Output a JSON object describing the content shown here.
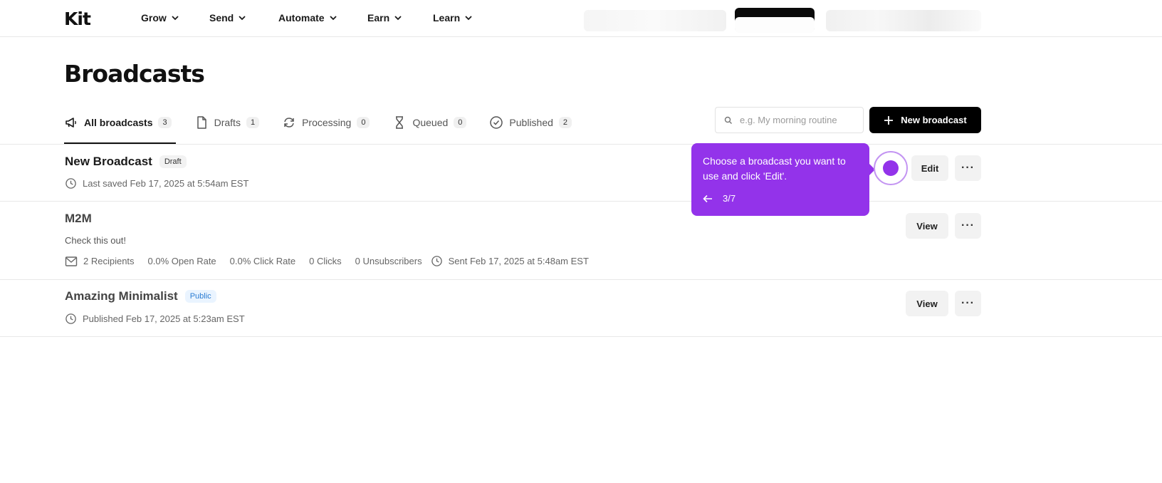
{
  "nav": {
    "logo": "Kit",
    "items": [
      "Grow",
      "Send",
      "Automate",
      "Earn",
      "Learn"
    ]
  },
  "page": {
    "title": "Broadcasts"
  },
  "tabs": [
    {
      "label": "All broadcasts",
      "count": "3",
      "icon": "megaphone-icon"
    },
    {
      "label": "Drafts",
      "count": "1",
      "icon": "document-icon"
    },
    {
      "label": "Processing",
      "count": "0",
      "icon": "refresh-icon"
    },
    {
      "label": "Queued",
      "count": "0",
      "icon": "hourglass-icon"
    },
    {
      "label": "Published",
      "count": "2",
      "icon": "check-circle-icon"
    }
  ],
  "search": {
    "placeholder": "e.g. My morning routine"
  },
  "new_broadcast_label": "New broadcast",
  "broadcasts": [
    {
      "title": "New Broadcast",
      "badge": "Draft",
      "meta": "Last saved Feb 17, 2025 at 5:54am EST",
      "action": "Edit"
    },
    {
      "title": "M2M",
      "description": "Check this out!",
      "stats": {
        "recipients": "2 Recipients",
        "open_rate": "0.0% Open Rate",
        "click_rate": "0.0% Click Rate",
        "clicks": "0 Clicks",
        "unsubscribers": "0 Unsubscribers",
        "sent": "Sent Feb 17, 2025 at 5:48am EST"
      },
      "action": "View"
    },
    {
      "title": "Amazing Minimalist",
      "badge": "Public",
      "meta": "Published Feb 17, 2025 at 5:23am EST",
      "action": "View"
    }
  ],
  "more_label": "···",
  "tooltip": {
    "message": "Choose a broadcast you want to use and click 'Edit'.",
    "step": "3/7"
  },
  "colors": {
    "accent": "#9333ea",
    "primary_button": "#000000",
    "public_badge": "#2b7cd3"
  }
}
